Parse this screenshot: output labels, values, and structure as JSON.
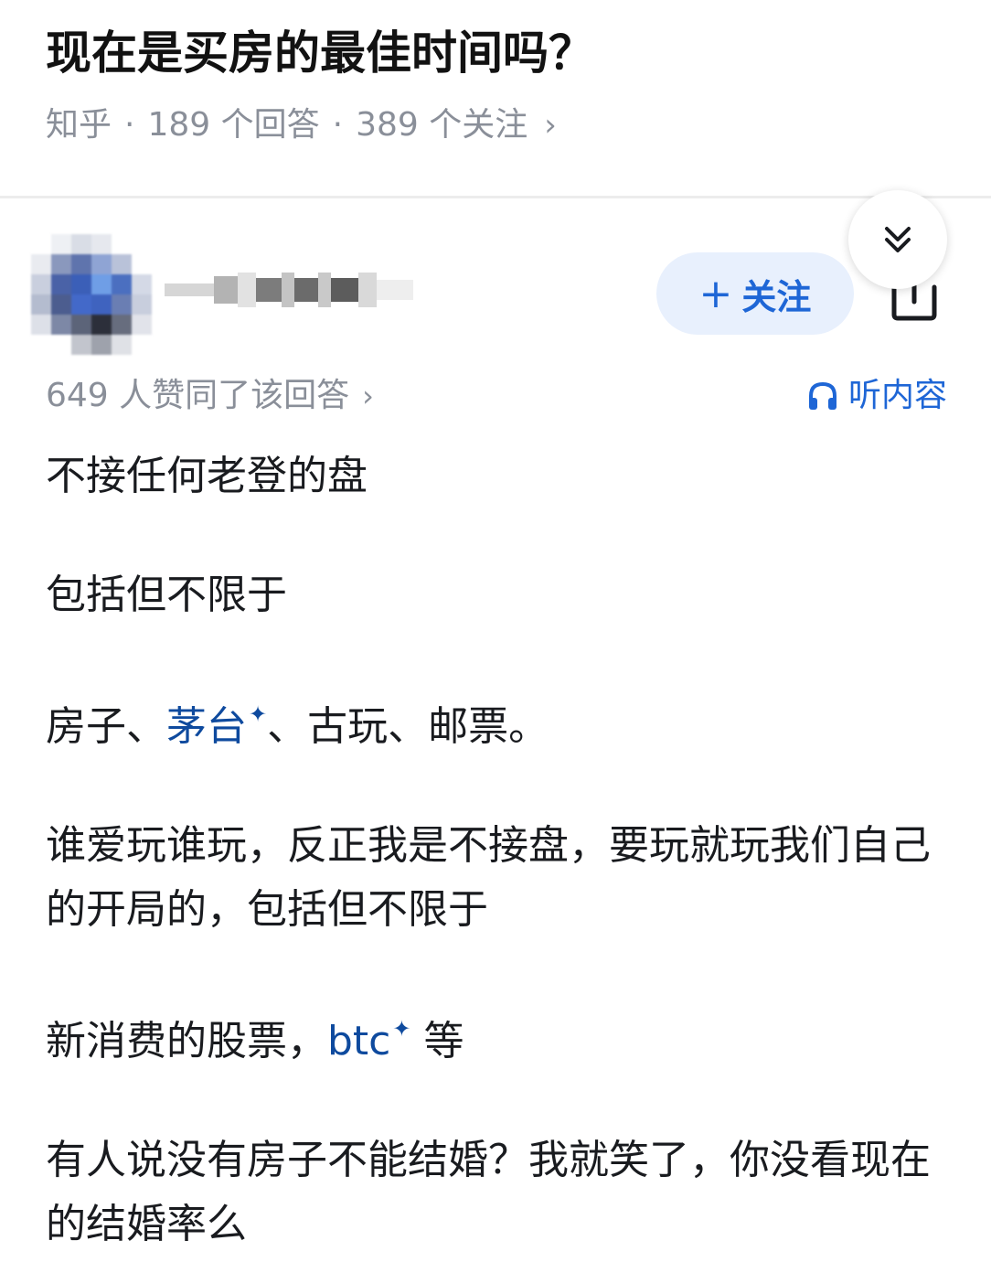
{
  "question": {
    "title": "现在是买房的最佳时间吗？",
    "source": "知乎",
    "answers_count": "189 个回答",
    "followers_count": "389 个关注",
    "separator": "·",
    "chevron": "›"
  },
  "author": {
    "follow_plus": "+",
    "follow_label": "关注"
  },
  "answer_meta": {
    "votes": "649 人赞同了该回答",
    "chevron": "›",
    "listen_label": "听内容"
  },
  "icons": {
    "collapse": "chevrons-down-icon",
    "share": "share-icon",
    "listen": "headphones-icon",
    "sparkle": "sparkle-icon"
  },
  "colors": {
    "link": "#0e4a9e",
    "accent": "#1e66d6",
    "follow_bg": "#e8f0fd",
    "meta": "#8a8f99"
  },
  "answer": {
    "p1": "不接任何老登的盘",
    "p2": "包括但不限于",
    "p3": {
      "part1": "房子、",
      "link1": "茅台",
      "part2": "、古玩、邮票。"
    },
    "p4": "谁爱玩谁玩，反正我是不接盘，要玩就玩我们自己的开局的，包括但不限于",
    "p5": {
      "part1": "新消费的股票，",
      "link1": "btc",
      "part2": " 等"
    },
    "p6": "有人说没有房子不能结婚？我就笑了，你没看现在的结婚率么",
    "sparkle": "✦"
  }
}
